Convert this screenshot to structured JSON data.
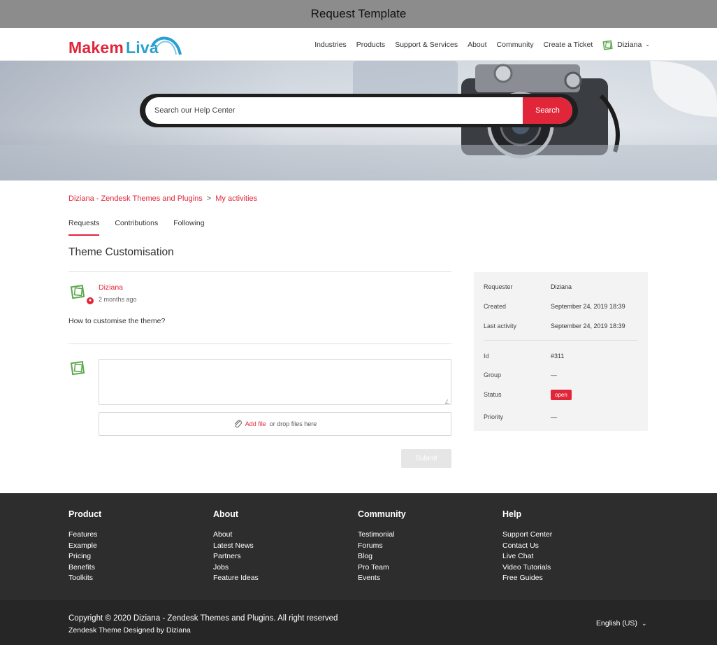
{
  "caption": "Request Template",
  "brand": {
    "word1": "Makem",
    "word2": "Liva",
    "red": "#e2263a",
    "blue": "#2a9fd0"
  },
  "nav": {
    "links": [
      "Industries",
      "Products",
      "Support & Services",
      "About",
      "Community",
      "Create a Ticket"
    ],
    "user_name": "Diziana"
  },
  "search": {
    "placeholder": "Search our Help Center",
    "button_label": "Search"
  },
  "breadcrumb": {
    "items": [
      "Diziana - Zendesk Themes and Plugins",
      "My activities"
    ],
    "separator": ">"
  },
  "tabs": [
    {
      "label": "Requests",
      "active": true
    },
    {
      "label": "Contributions",
      "active": false
    },
    {
      "label": "Following",
      "active": false
    }
  ],
  "request": {
    "title": "Theme Customisation",
    "comment": {
      "author": "Diziana",
      "time": "2 months ago",
      "body": "How to customise the theme?"
    }
  },
  "reply": {
    "attach_link": "Add file",
    "attach_text": "or drop files here",
    "submit_label": "Submit"
  },
  "details": {
    "requester_label": "Requester",
    "requester": "Diziana",
    "created_label": "Created",
    "created": "September 24, 2019 18:39",
    "last_activity_label": "Last activity",
    "last_activity": "September 24, 2019 18:39",
    "id_label": "Id",
    "id": "#311",
    "group_label": "Group",
    "group": "—",
    "status_label": "Status",
    "status": "open",
    "priority_label": "Priority",
    "priority": "—"
  },
  "footer": {
    "columns": [
      {
        "title": "Product",
        "links": [
          "Features",
          "Example",
          "Pricing",
          "Benefits",
          "Toolkits"
        ]
      },
      {
        "title": "About",
        "links": [
          "About",
          "Latest News",
          "Partners",
          "Jobs",
          "Feature Ideas"
        ]
      },
      {
        "title": "Community",
        "links": [
          "Testimonial",
          "Forums",
          "Blog",
          "Pro Team",
          "Events"
        ]
      },
      {
        "title": "Help",
        "links": [
          "Support Center",
          "Contact Us",
          "Live Chat",
          "Video Tutorials",
          "Free Guides"
        ]
      }
    ],
    "copyright": "Copyright © 2020 Diziana - Zendesk Themes and Plugins. All right reserved",
    "credit": "Zendesk Theme Designed by Diziana",
    "language": "English (US)"
  }
}
